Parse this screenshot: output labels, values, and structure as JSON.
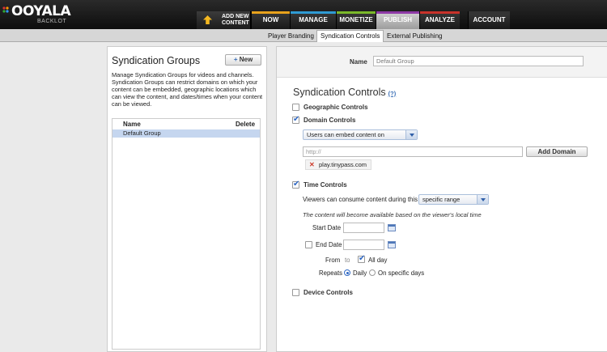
{
  "header": {
    "logo_text": "OOYALA",
    "logo_sub": "BACKLOT",
    "add_new_line1": "ADD NEW",
    "add_new_line2": "CONTENT",
    "nav": [
      {
        "label": "NOW",
        "color": "#e8a21c"
      },
      {
        "label": "MANAGE",
        "color": "#2f9bd3"
      },
      {
        "label": "MONETIZE",
        "color": "#7ab829"
      },
      {
        "label": "PUBLISH",
        "color": "#8e3aa6"
      },
      {
        "label": "ANALYZE",
        "color": "#c8322a"
      },
      {
        "label": "ACCOUNT",
        "color": "#333333"
      }
    ],
    "active_nav": "PUBLISH"
  },
  "subnav": {
    "tabs": [
      "Player Branding",
      "Syndication Controls",
      "External Publishing"
    ],
    "active": "Syndication Controls"
  },
  "left_panel": {
    "title": "Syndication Groups",
    "new_button": "New",
    "description": "Manage Syndication Groups for videos and channels. Syndication Groups can restrict domains on which your content can be embedded, geographic locations which can view the content, and dates/times when your content can be viewed.",
    "table": {
      "col_name": "Name",
      "col_delete": "Delete",
      "rows": [
        "Default Group"
      ]
    }
  },
  "right_panel": {
    "name_label": "Name",
    "name_value": "Default Group",
    "section_title": "Syndication Controls",
    "help": "(?)",
    "geographic": {
      "label": "Geographic Controls",
      "checked": false
    },
    "domain": {
      "label": "Domain Controls",
      "checked": true,
      "mode": "Users can embed content on",
      "input_placeholder": "http://",
      "add_button": "Add Domain",
      "domains": [
        "play.tinypass.com"
      ]
    },
    "time": {
      "label": "Time Controls",
      "checked": true,
      "consume_prefix": "Viewers can consume content during this",
      "range_mode": "specific range",
      "note": "The content will become available based on the viewer's local time",
      "start_label": "Start Date",
      "end_label": "End Date",
      "from_label": "From",
      "to_label": "to",
      "all_day": "All day",
      "repeats_label": "Repeats",
      "repeat_daily": "Daily",
      "repeat_specific": "On specific days"
    },
    "device": {
      "label": "Device Controls",
      "checked": false
    }
  }
}
